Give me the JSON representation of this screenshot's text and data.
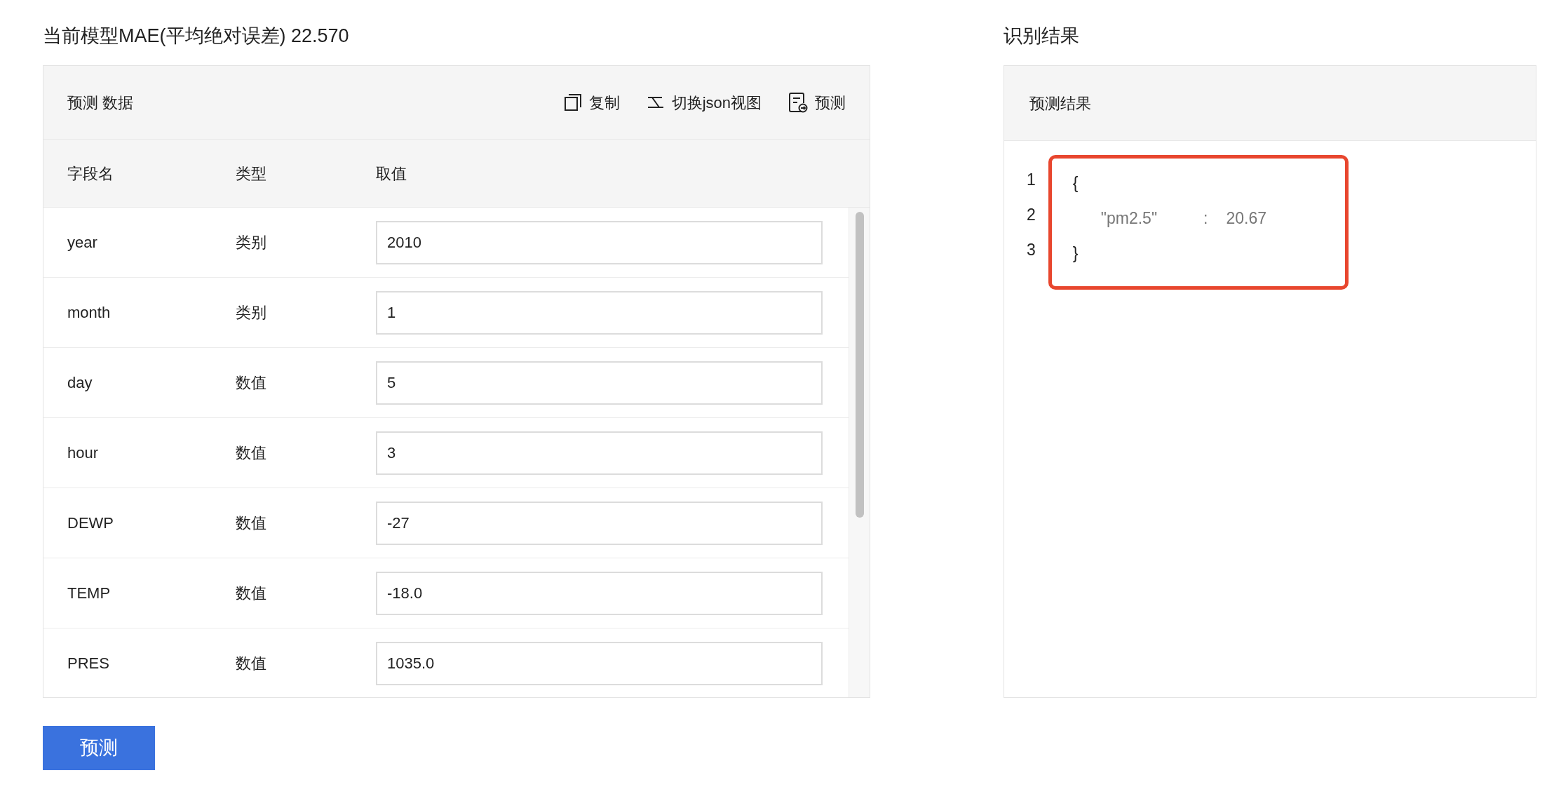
{
  "left": {
    "title": "当前模型MAE(平均绝对误差) 22.570",
    "panel": {
      "title": "预测 数据",
      "actions": [
        {
          "kind": "copy",
          "label": "复制"
        },
        {
          "kind": "switch",
          "label": "切换json视图"
        },
        {
          "kind": "predict",
          "label": "预测"
        }
      ]
    },
    "columns": [
      "字段名",
      "类型",
      "取值"
    ],
    "rows": [
      {
        "name": "year",
        "type": "类别",
        "value": "2010"
      },
      {
        "name": "month",
        "type": "类别",
        "value": "1"
      },
      {
        "name": "day",
        "type": "数值",
        "value": "5"
      },
      {
        "name": "hour",
        "type": "数值",
        "value": "3"
      },
      {
        "name": "DEWP",
        "type": "数值",
        "value": "-27"
      },
      {
        "name": "TEMP",
        "type": "数值",
        "value": "-18.0"
      },
      {
        "name": "PRES",
        "type": "数值",
        "value": "1035.0"
      }
    ],
    "button": "预测"
  },
  "right": {
    "title": "识别结果",
    "panel_title": "预测结果",
    "highlighted": true,
    "lines": [
      {
        "number": "1",
        "tokens": [
          {
            "kind": "brace",
            "text": "{"
          }
        ]
      },
      {
        "number": "2",
        "tokens": [
          {
            "kind": "key",
            "text": "\"pm2.5\""
          },
          {
            "kind": "colon",
            "text": ":"
          },
          {
            "kind": "value",
            "text": "20.67"
          }
        ]
      },
      {
        "number": "3",
        "tokens": [
          {
            "kind": "brace",
            "text": "}"
          }
        ]
      }
    ]
  }
}
